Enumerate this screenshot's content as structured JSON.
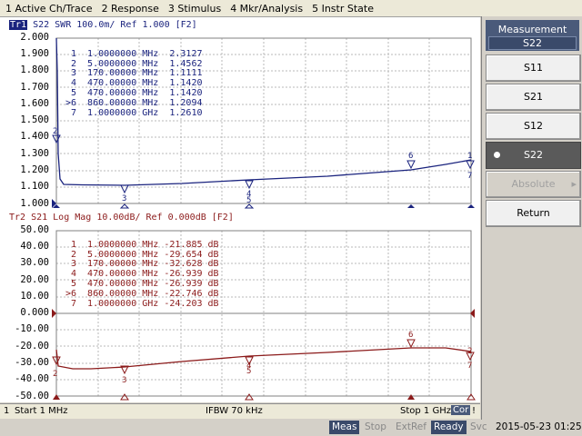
{
  "menu": [
    "1 Active Ch/Trace",
    "2 Response",
    "3 Stimulus",
    "4 Mkr/Analysis",
    "5 Instr State"
  ],
  "trace1": {
    "tag": "Tr1",
    "title": " S22  SWR 100.0m/ Ref 1.000 [F2]",
    "color": "#1a237e",
    "y_labels": [
      "2.000",
      "1.900",
      "1.800",
      "1.700",
      "1.600",
      "1.500",
      "1.400",
      "1.300",
      "1.200",
      "1.100",
      "1.000"
    ],
    "markers": [
      {
        "id": "1",
        "freq": "1.0000000 MHz",
        "val": "2.3127"
      },
      {
        "id": "2",
        "freq": "5.0000000 MHz",
        "val": "1.4562"
      },
      {
        "id": "3",
        "freq": "170.00000 MHz",
        "val": "1.1111"
      },
      {
        "id": "4",
        "freq": "470.00000 MHz",
        "val": "1.1420"
      },
      {
        "id": "5",
        "freq": "470.00000 MHz",
        "val": "1.1420"
      },
      {
        "id": ">6",
        "freq": "860.00000 MHz",
        "val": "1.2094"
      },
      {
        "id": "7",
        "freq": "1.0000000 GHz",
        "val": "1.2610"
      }
    ]
  },
  "trace2": {
    "title": "Tr2 S21 Log Mag 10.00dB/ Ref 0.000dB [F2]",
    "color": "#8b1a1a",
    "y_labels": [
      "50.00",
      "40.00",
      "30.00",
      "20.00",
      "10.00",
      "0.000",
      "-10.00",
      "-20.00",
      "-30.00",
      "-40.00",
      "-50.00"
    ],
    "markers": [
      {
        "id": "1",
        "freq": "1.0000000 MHz",
        "val": "-21.885 dB"
      },
      {
        "id": "2",
        "freq": "5.0000000 MHz",
        "val": "-29.654 dB"
      },
      {
        "id": "3",
        "freq": "170.00000 MHz",
        "val": "-32.628 dB"
      },
      {
        "id": "4",
        "freq": "470.00000 MHz",
        "val": "-26.939 dB"
      },
      {
        "id": "5",
        "freq": "470.00000 MHz",
        "val": "-26.939 dB"
      },
      {
        "id": ">6",
        "freq": "860.00000 MHz",
        "val": "-22.746 dB"
      },
      {
        "id": "7",
        "freq": "1.0000000 GHz",
        "val": "-24.203 dB"
      }
    ]
  },
  "softkeys": {
    "title": "Measurement",
    "current": "S22",
    "buttons": [
      "S11",
      "S21",
      "S12",
      "S22",
      "Absolute",
      "Return"
    ]
  },
  "status": {
    "channel": "1",
    "start": "Start 1 MHz",
    "ifbw": "IFBW 70 kHz",
    "stop": "Stop 1 GHz",
    "cor": "Cor",
    "flag": "!"
  },
  "bottom": {
    "meas": "Meas",
    "stop": "Stop",
    "extref": "ExtRef",
    "ready": "Ready",
    "svc": "Svc",
    "datetime": "2015-05-23 01:25"
  }
}
